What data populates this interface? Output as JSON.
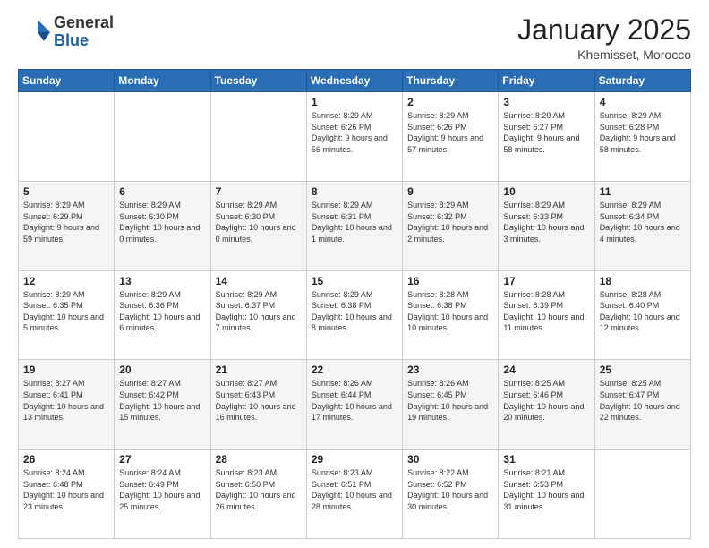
{
  "header": {
    "logo_general": "General",
    "logo_blue": "Blue",
    "month_title": "January 2025",
    "location": "Khemisset, Morocco"
  },
  "days_of_week": [
    "Sunday",
    "Monday",
    "Tuesday",
    "Wednesday",
    "Thursday",
    "Friday",
    "Saturday"
  ],
  "weeks": [
    [
      {
        "day": "",
        "info": ""
      },
      {
        "day": "",
        "info": ""
      },
      {
        "day": "",
        "info": ""
      },
      {
        "day": "1",
        "info": "Sunrise: 8:29 AM\nSunset: 6:26 PM\nDaylight: 9 hours\nand 56 minutes."
      },
      {
        "day": "2",
        "info": "Sunrise: 8:29 AM\nSunset: 6:26 PM\nDaylight: 9 hours\nand 57 minutes."
      },
      {
        "day": "3",
        "info": "Sunrise: 8:29 AM\nSunset: 6:27 PM\nDaylight: 9 hours\nand 58 minutes."
      },
      {
        "day": "4",
        "info": "Sunrise: 8:29 AM\nSunset: 6:28 PM\nDaylight: 9 hours\nand 58 minutes."
      }
    ],
    [
      {
        "day": "5",
        "info": "Sunrise: 8:29 AM\nSunset: 6:29 PM\nDaylight: 9 hours\nand 59 minutes."
      },
      {
        "day": "6",
        "info": "Sunrise: 8:29 AM\nSunset: 6:30 PM\nDaylight: 10 hours\nand 0 minutes."
      },
      {
        "day": "7",
        "info": "Sunrise: 8:29 AM\nSunset: 6:30 PM\nDaylight: 10 hours\nand 0 minutes."
      },
      {
        "day": "8",
        "info": "Sunrise: 8:29 AM\nSunset: 6:31 PM\nDaylight: 10 hours\nand 1 minute."
      },
      {
        "day": "9",
        "info": "Sunrise: 8:29 AM\nSunset: 6:32 PM\nDaylight: 10 hours\nand 2 minutes."
      },
      {
        "day": "10",
        "info": "Sunrise: 8:29 AM\nSunset: 6:33 PM\nDaylight: 10 hours\nand 3 minutes."
      },
      {
        "day": "11",
        "info": "Sunrise: 8:29 AM\nSunset: 6:34 PM\nDaylight: 10 hours\nand 4 minutes."
      }
    ],
    [
      {
        "day": "12",
        "info": "Sunrise: 8:29 AM\nSunset: 6:35 PM\nDaylight: 10 hours\nand 5 minutes."
      },
      {
        "day": "13",
        "info": "Sunrise: 8:29 AM\nSunset: 6:36 PM\nDaylight: 10 hours\nand 6 minutes."
      },
      {
        "day": "14",
        "info": "Sunrise: 8:29 AM\nSunset: 6:37 PM\nDaylight: 10 hours\nand 7 minutes."
      },
      {
        "day": "15",
        "info": "Sunrise: 8:29 AM\nSunset: 6:38 PM\nDaylight: 10 hours\nand 8 minutes."
      },
      {
        "day": "16",
        "info": "Sunrise: 8:28 AM\nSunset: 6:38 PM\nDaylight: 10 hours\nand 10 minutes."
      },
      {
        "day": "17",
        "info": "Sunrise: 8:28 AM\nSunset: 6:39 PM\nDaylight: 10 hours\nand 11 minutes."
      },
      {
        "day": "18",
        "info": "Sunrise: 8:28 AM\nSunset: 6:40 PM\nDaylight: 10 hours\nand 12 minutes."
      }
    ],
    [
      {
        "day": "19",
        "info": "Sunrise: 8:27 AM\nSunset: 6:41 PM\nDaylight: 10 hours\nand 13 minutes."
      },
      {
        "day": "20",
        "info": "Sunrise: 8:27 AM\nSunset: 6:42 PM\nDaylight: 10 hours\nand 15 minutes."
      },
      {
        "day": "21",
        "info": "Sunrise: 8:27 AM\nSunset: 6:43 PM\nDaylight: 10 hours\nand 16 minutes."
      },
      {
        "day": "22",
        "info": "Sunrise: 8:26 AM\nSunset: 6:44 PM\nDaylight: 10 hours\nand 17 minutes."
      },
      {
        "day": "23",
        "info": "Sunrise: 8:26 AM\nSunset: 6:45 PM\nDaylight: 10 hours\nand 19 minutes."
      },
      {
        "day": "24",
        "info": "Sunrise: 8:25 AM\nSunset: 6:46 PM\nDaylight: 10 hours\nand 20 minutes."
      },
      {
        "day": "25",
        "info": "Sunrise: 8:25 AM\nSunset: 6:47 PM\nDaylight: 10 hours\nand 22 minutes."
      }
    ],
    [
      {
        "day": "26",
        "info": "Sunrise: 8:24 AM\nSunset: 6:48 PM\nDaylight: 10 hours\nand 23 minutes."
      },
      {
        "day": "27",
        "info": "Sunrise: 8:24 AM\nSunset: 6:49 PM\nDaylight: 10 hours\nand 25 minutes."
      },
      {
        "day": "28",
        "info": "Sunrise: 8:23 AM\nSunset: 6:50 PM\nDaylight: 10 hours\nand 26 minutes."
      },
      {
        "day": "29",
        "info": "Sunrise: 8:23 AM\nSunset: 6:51 PM\nDaylight: 10 hours\nand 28 minutes."
      },
      {
        "day": "30",
        "info": "Sunrise: 8:22 AM\nSunset: 6:52 PM\nDaylight: 10 hours\nand 30 minutes."
      },
      {
        "day": "31",
        "info": "Sunrise: 8:21 AM\nSunset: 6:53 PM\nDaylight: 10 hours\nand 31 minutes."
      },
      {
        "day": "",
        "info": ""
      }
    ]
  ]
}
